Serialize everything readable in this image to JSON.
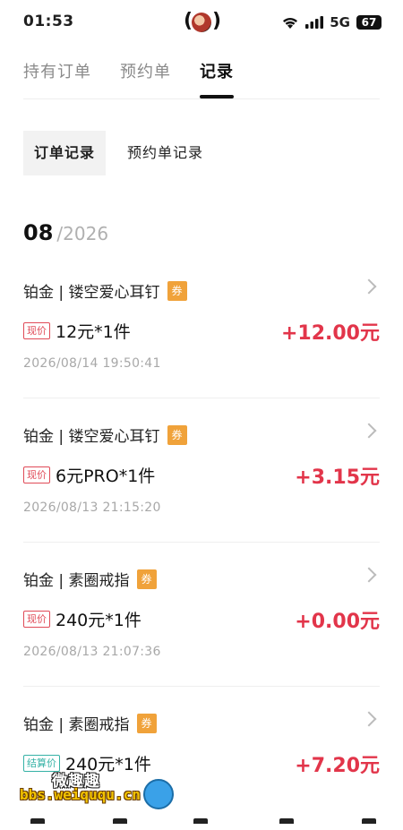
{
  "status": {
    "time": "01:53",
    "network": "5G",
    "battery": "67"
  },
  "tabs": [
    {
      "label": "持有订单",
      "active": false
    },
    {
      "label": "预约单",
      "active": false
    },
    {
      "label": "记录",
      "active": true
    }
  ],
  "segments": [
    {
      "label": "订单记录",
      "active": true
    },
    {
      "label": "预约单记录",
      "active": false
    }
  ],
  "month": {
    "num": "08",
    "year": "/2026"
  },
  "records": [
    {
      "title": "铂金 | 镂空爱心耳钉",
      "coupon": "券",
      "tag": "现价",
      "tag_type": "current",
      "price": "12元*1件",
      "amount": "+12.00元",
      "time": "2026/08/14 19:50:41"
    },
    {
      "title": "铂金 | 镂空爱心耳钉",
      "coupon": "券",
      "tag": "现价",
      "tag_type": "current",
      "price": "6元PRO*1件",
      "amount": "+3.15元",
      "time": "2026/08/13 21:15:20"
    },
    {
      "title": "铂金 | 素圈戒指",
      "coupon": "券",
      "tag": "现价",
      "tag_type": "current",
      "price": "240元*1件",
      "amount": "+0.00元",
      "time": "2026/08/13 21:07:36"
    },
    {
      "title": "铂金 | 素圈戒指",
      "coupon": "券",
      "tag": "结算价",
      "tag_type": "settle",
      "price": "240元*1件",
      "amount": "+7.20元",
      "time": ""
    }
  ],
  "watermark": {
    "cn": "微趣趣",
    "url": "bbs.weiququ.cn"
  },
  "colors": {
    "accent_red": "#e2354a",
    "coupon_orange": "#f0a23a",
    "settle_teal": "#35b2a6"
  }
}
